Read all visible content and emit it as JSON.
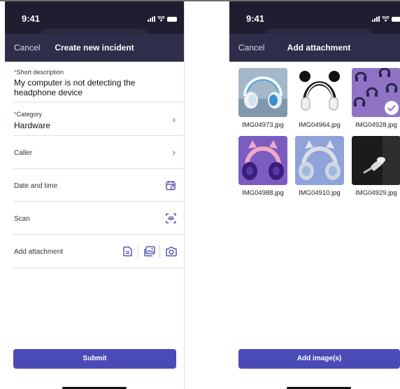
{
  "status_time": "9:41",
  "incident": {
    "cancel_label": "Cancel",
    "title": "Create new incident",
    "short_description_label": "Short description",
    "short_description_value": "My computer is not detecting the headphone device",
    "category_label": "Category",
    "category_value": "Hardware",
    "caller_label": "Caller",
    "date_time_label": "Date and time",
    "scan_label": "Scan",
    "attachment_label": "Add attachment",
    "submit_label": "Submit",
    "required_marker": "*"
  },
  "attachment": {
    "cancel_label": "Cancel",
    "title": "Add attachment",
    "images": [
      {
        "file": "IMG04973.jpg",
        "selected": false,
        "bg": "#9fb5c3"
      },
      {
        "file": "IMG04964.jpg",
        "selected": false,
        "bg": "#ffffff"
      },
      {
        "file": "IMG04928.jpg",
        "selected": true,
        "bg": "#8e72c4"
      },
      {
        "file": "IMG04988.jpg",
        "selected": false,
        "bg": "#7a5bbf"
      },
      {
        "file": "IMG04910.jpg",
        "selected": false,
        "bg": "#8ea0d8"
      },
      {
        "file": "IMG04929.jpg",
        "selected": false,
        "bg": "#1c1c1c"
      }
    ],
    "add_button_label": "Add image(s)"
  },
  "colors": {
    "header_dark": "#1f1e31",
    "navbar": "#2e2d4a",
    "accent": "#4b4bb8",
    "required": "#d32f2f"
  },
  "icons": [
    "signal-icon",
    "wifi-icon",
    "battery-icon",
    "chevron-right-icon",
    "calendar-icon",
    "scan-icon",
    "document-icon",
    "gallery-icon",
    "camera-icon",
    "checkmark-icon"
  ]
}
